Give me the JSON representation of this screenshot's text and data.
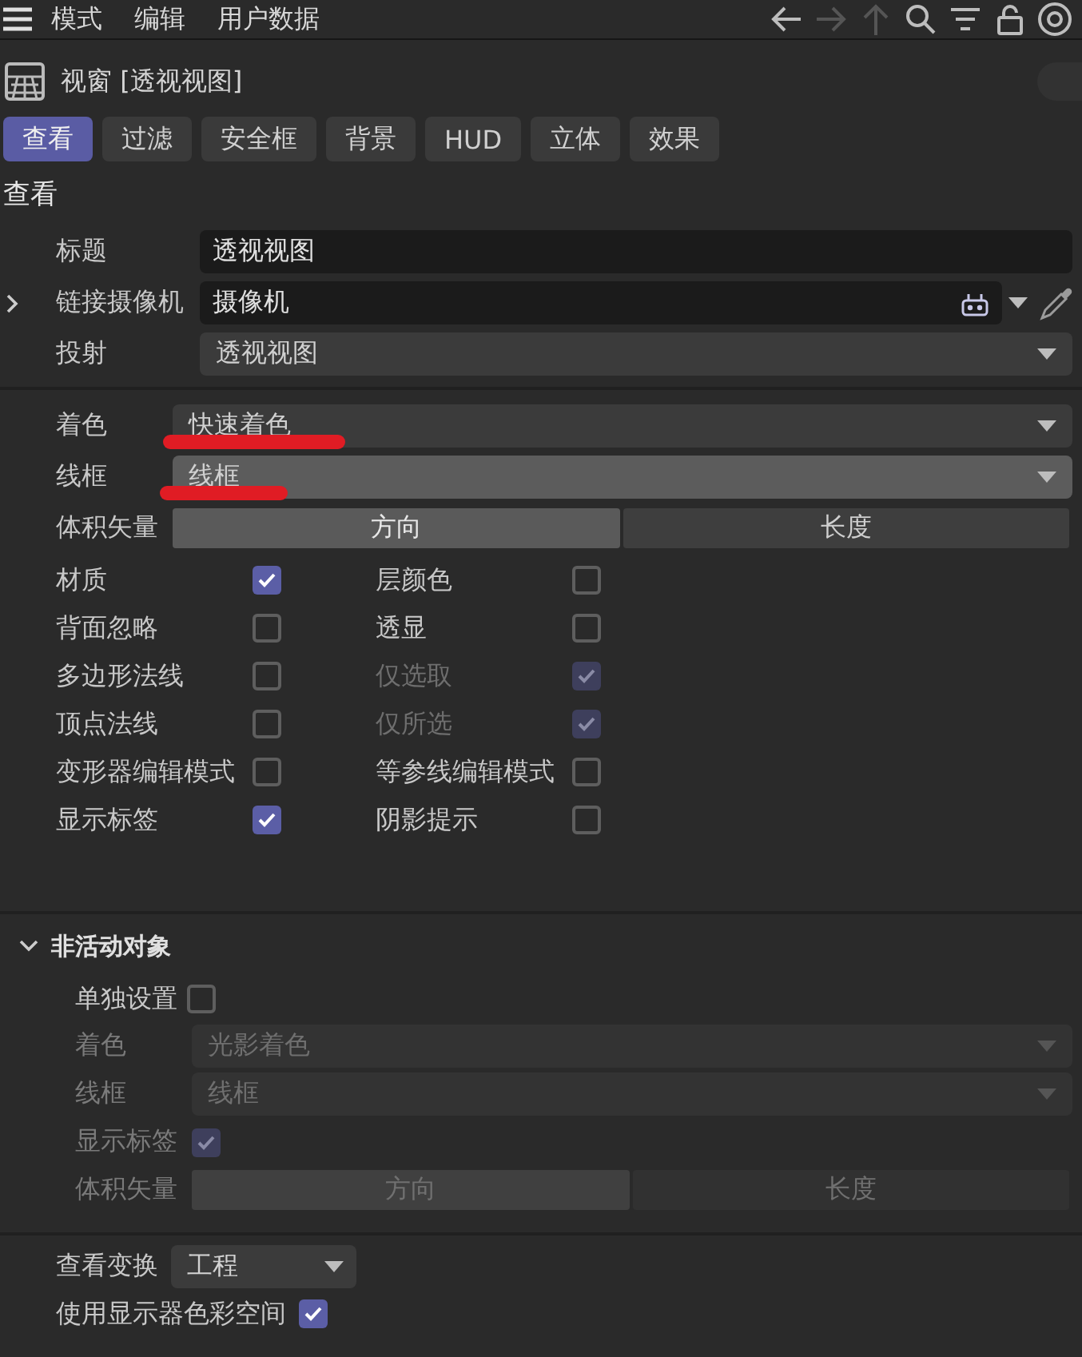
{
  "menu": [
    "模式",
    "编辑",
    "用户数据"
  ],
  "toolbar": [
    {
      "kind": "back",
      "disabled": false
    },
    {
      "kind": "forward",
      "disabled": true
    },
    {
      "kind": "up",
      "disabled": true
    },
    {
      "kind": "search",
      "disabled": false
    },
    {
      "kind": "filter",
      "disabled": false
    },
    {
      "kind": "lock",
      "disabled": false
    },
    {
      "kind": "target",
      "disabled": false
    }
  ],
  "panel_title": "视窗 [透视视图]",
  "panel_toggle": {
    "on": false
  },
  "tabs": [
    {
      "label": "查看",
      "selected": true
    },
    {
      "label": "过滤",
      "selected": false
    },
    {
      "label": "安全框",
      "selected": false
    },
    {
      "label": "背景",
      "selected": false
    },
    {
      "label": "HUD",
      "selected": false
    },
    {
      "label": "立体",
      "selected": false
    },
    {
      "label": "效果",
      "selected": false
    }
  ],
  "section_title": "查看",
  "basic_fields": [
    {
      "label": "标题",
      "kind": "text",
      "value": "透视视图"
    },
    {
      "label": "链接摄像机",
      "kind": "link",
      "value": "摄像机",
      "expanded": false
    },
    {
      "label": "投射",
      "kind": "dropdown",
      "value": "透视视图"
    }
  ],
  "display_fields": [
    {
      "label": "着色",
      "value": "快速着色",
      "highlighted": false,
      "marked": true
    },
    {
      "label": "线框",
      "value": "线框",
      "highlighted": true,
      "marked": true
    }
  ],
  "volume_vector": {
    "label": "体积矢量",
    "options": [
      {
        "label": "方向",
        "selected": true
      },
      {
        "label": "长度",
        "selected": false
      }
    ]
  },
  "checkboxes": [
    {
      "label": "材质",
      "checked": true,
      "disabled": false
    },
    {
      "label": "层颜色",
      "checked": false,
      "disabled": false
    },
    {
      "label": "背面忽略",
      "checked": false,
      "disabled": false
    },
    {
      "label": "透显",
      "checked": false,
      "disabled": false
    },
    {
      "label": "多边形法线",
      "checked": false,
      "disabled": false
    },
    {
      "label": "仅选取",
      "checked": true,
      "disabled": true
    },
    {
      "label": "顶点法线",
      "checked": false,
      "disabled": false
    },
    {
      "label": "仅所选",
      "checked": true,
      "disabled": true
    },
    {
      "label": "变形器编辑模式",
      "checked": false,
      "disabled": false
    },
    {
      "label": "等参线编辑模式",
      "checked": false,
      "disabled": false
    },
    {
      "label": "显示标签",
      "checked": true,
      "disabled": false
    },
    {
      "label": "阴影提示",
      "checked": false,
      "disabled": false
    }
  ],
  "inactive": {
    "title": "非活动对象",
    "expanded": true,
    "solo": {
      "label": "单独设置",
      "checked": false
    },
    "fields": [
      {
        "label": "着色",
        "value": "光影着色",
        "disabled": true
      },
      {
        "label": "线框",
        "value": "线框",
        "disabled": true
      }
    ],
    "show_labels": {
      "label": "显示标签",
      "checked": true,
      "disabled": true
    },
    "volume_vector": {
      "label": "体积矢量",
      "disabled": true,
      "options": [
        {
          "label": "方向",
          "selected": true
        },
        {
          "label": "长度",
          "selected": false
        }
      ]
    }
  },
  "view_transform": {
    "label": "查看变换",
    "value": "工程"
  },
  "display_color_space": {
    "label": "使用显示器色彩空间",
    "checked": true
  }
}
